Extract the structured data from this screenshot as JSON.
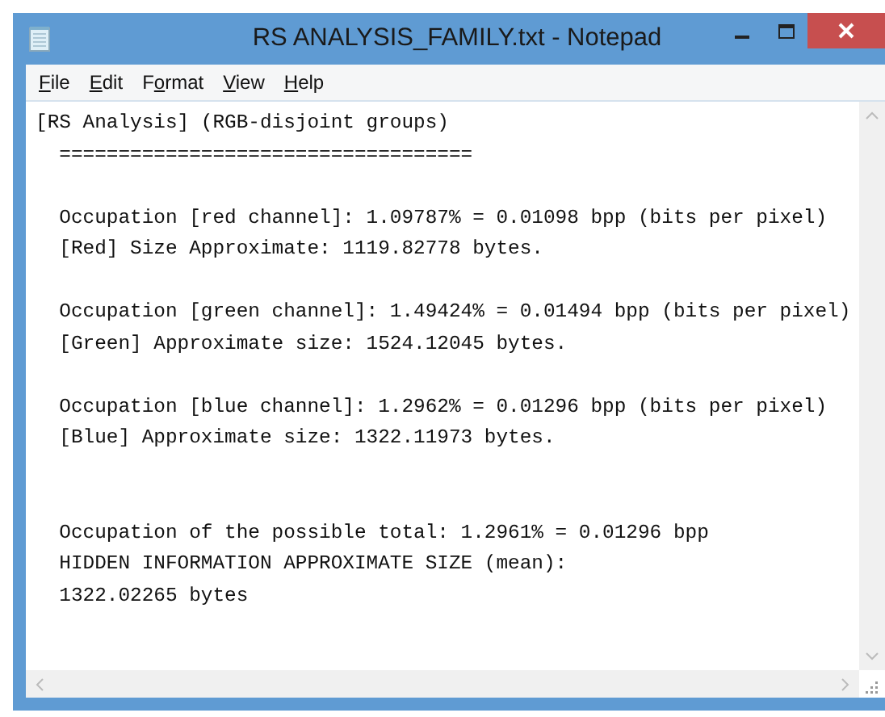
{
  "window": {
    "title": "RS ANALYSIS_FAMILY.txt - Notepad"
  },
  "menu": [
    {
      "label": "File"
    },
    {
      "label": "Edit"
    },
    {
      "label": "Format"
    },
    {
      "label": "View"
    },
    {
      "label": "Help"
    }
  ],
  "document": {
    "blocks": [
      {
        "lines": [
          "[RS Analysis] (RGB-disjoint groups)",
          "  ==================================="
        ]
      },
      {
        "lines": [
          "  Occupation [red channel]: 1.09787% = 0.01098 bpp (bits per pixel)",
          "  [Red] Size Approximate: 1119.82778 bytes."
        ]
      },
      {
        "lines": [
          "  Occupation [green channel]: 1.49424% = 0.01494 bpp (bits per pixel)",
          "  [Green] Approximate size: 1524.12045 bytes."
        ]
      },
      {
        "lines": [
          "  Occupation [blue channel]: 1.2962% = 0.01296 bpp (bits per pixel)",
          "  [Blue] Approximate size: 1322.11973 bytes."
        ]
      },
      {
        "lines": [
          "  Occupation of the possible total: 1.2961% = 0.01296 bpp",
          "  HIDDEN INFORMATION APPROXIMATE SIZE (mean):",
          "  1322.02265 bytes"
        ]
      }
    ]
  }
}
